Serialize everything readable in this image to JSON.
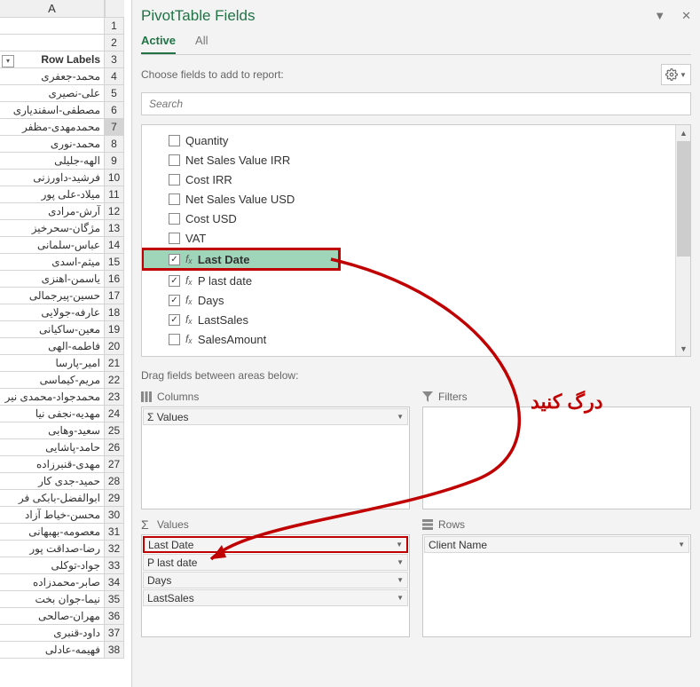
{
  "sheet": {
    "col": "A",
    "header_cell": "Row Labels",
    "selected_row": 7,
    "rows": [
      {
        "n": 1,
        "v": ""
      },
      {
        "n": 2,
        "v": ""
      },
      {
        "n": 3,
        "v": "Row Labels"
      },
      {
        "n": 4,
        "v": "محمد-جعفری"
      },
      {
        "n": 5,
        "v": "علی-نصیری"
      },
      {
        "n": 6,
        "v": "مصطفی-اسفندیاری"
      },
      {
        "n": 7,
        "v": "محمدمهدی-مظفر"
      },
      {
        "n": 8,
        "v": "محمد-نوری"
      },
      {
        "n": 9,
        "v": "الهه-جلیلی"
      },
      {
        "n": 10,
        "v": "فرشید-داورزنی"
      },
      {
        "n": 11,
        "v": "میلاد-علی پور"
      },
      {
        "n": 12,
        "v": "آرش-مرادی"
      },
      {
        "n": 13,
        "v": "مژگان-سحرخیز"
      },
      {
        "n": 14,
        "v": "عباس-سلمانی"
      },
      {
        "n": 15,
        "v": "میثم-اسدی"
      },
      {
        "n": 16,
        "v": "یاسمن-اهنزی"
      },
      {
        "n": 17,
        "v": "حسین-پیرجمالی"
      },
      {
        "n": 18,
        "v": "عارفه-جولایی"
      },
      {
        "n": 19,
        "v": "معین-ساکیانی"
      },
      {
        "n": 20,
        "v": "فاطمه-الهی"
      },
      {
        "n": 21,
        "v": "امیر-پارسا"
      },
      {
        "n": 22,
        "v": "مریم-کیماسی"
      },
      {
        "n": 23,
        "v": "محمدجواد-محمدی نیر"
      },
      {
        "n": 24,
        "v": "مهدیه-نجفی نیا"
      },
      {
        "n": 25,
        "v": "سعید-وهابی"
      },
      {
        "n": 26,
        "v": "حامد-پاشایی"
      },
      {
        "n": 27,
        "v": "مهدی-قنبرزاده"
      },
      {
        "n": 28,
        "v": "حمید-جدی کار"
      },
      {
        "n": 29,
        "v": "ابوالفضل-بابکی فر"
      },
      {
        "n": 30,
        "v": "محسن-خیاط آزاد"
      },
      {
        "n": 31,
        "v": "معصومه-بهبهانی"
      },
      {
        "n": 32,
        "v": "رضا-صداقت پور"
      },
      {
        "n": 33,
        "v": "جواد-توکلی"
      },
      {
        "n": 34,
        "v": "صابر-محمدزاده"
      },
      {
        "n": 35,
        "v": "نیما-جوان بخت"
      },
      {
        "n": 36,
        "v": "مهران-صالحی"
      },
      {
        "n": 37,
        "v": "داود-قنبری"
      },
      {
        "n": 38,
        "v": "فهیمه-عادلی"
      }
    ]
  },
  "pane": {
    "title": "PivotTable Fields",
    "tabs": {
      "active": "Active",
      "all": "All"
    },
    "choose_text": "Choose fields to add to report:",
    "search_placeholder": "Search",
    "fields": [
      {
        "label": "Quantity",
        "checked": false,
        "fx": false
      },
      {
        "label": "Net Sales Value IRR",
        "checked": false,
        "fx": false
      },
      {
        "label": "Cost IRR",
        "checked": false,
        "fx": false
      },
      {
        "label": "Net Sales Value USD",
        "checked": false,
        "fx": false
      },
      {
        "label": "Cost USD",
        "checked": false,
        "fx": false
      },
      {
        "label": "VAT",
        "checked": false,
        "fx": false
      },
      {
        "label": "Last Date",
        "checked": true,
        "fx": true,
        "highlight": true
      },
      {
        "label": "P last date",
        "checked": true,
        "fx": true
      },
      {
        "label": "Days",
        "checked": true,
        "fx": true
      },
      {
        "label": "LastSales",
        "checked": true,
        "fx": true
      },
      {
        "label": "SalesAmount",
        "checked": false,
        "fx": true
      }
    ],
    "drag_hint": "Drag fields between areas below:",
    "areas": {
      "columns": {
        "label": "Columns",
        "items": [
          "Σ Values"
        ]
      },
      "filters": {
        "label": "Filters",
        "items": []
      },
      "values": {
        "label": "Values",
        "items": [
          "Last Date",
          "P last date",
          "Days",
          "LastSales"
        ]
      },
      "rows": {
        "label": "Rows",
        "items": [
          "Client Name"
        ]
      }
    }
  },
  "annotation": {
    "text": "درگ کنید"
  }
}
